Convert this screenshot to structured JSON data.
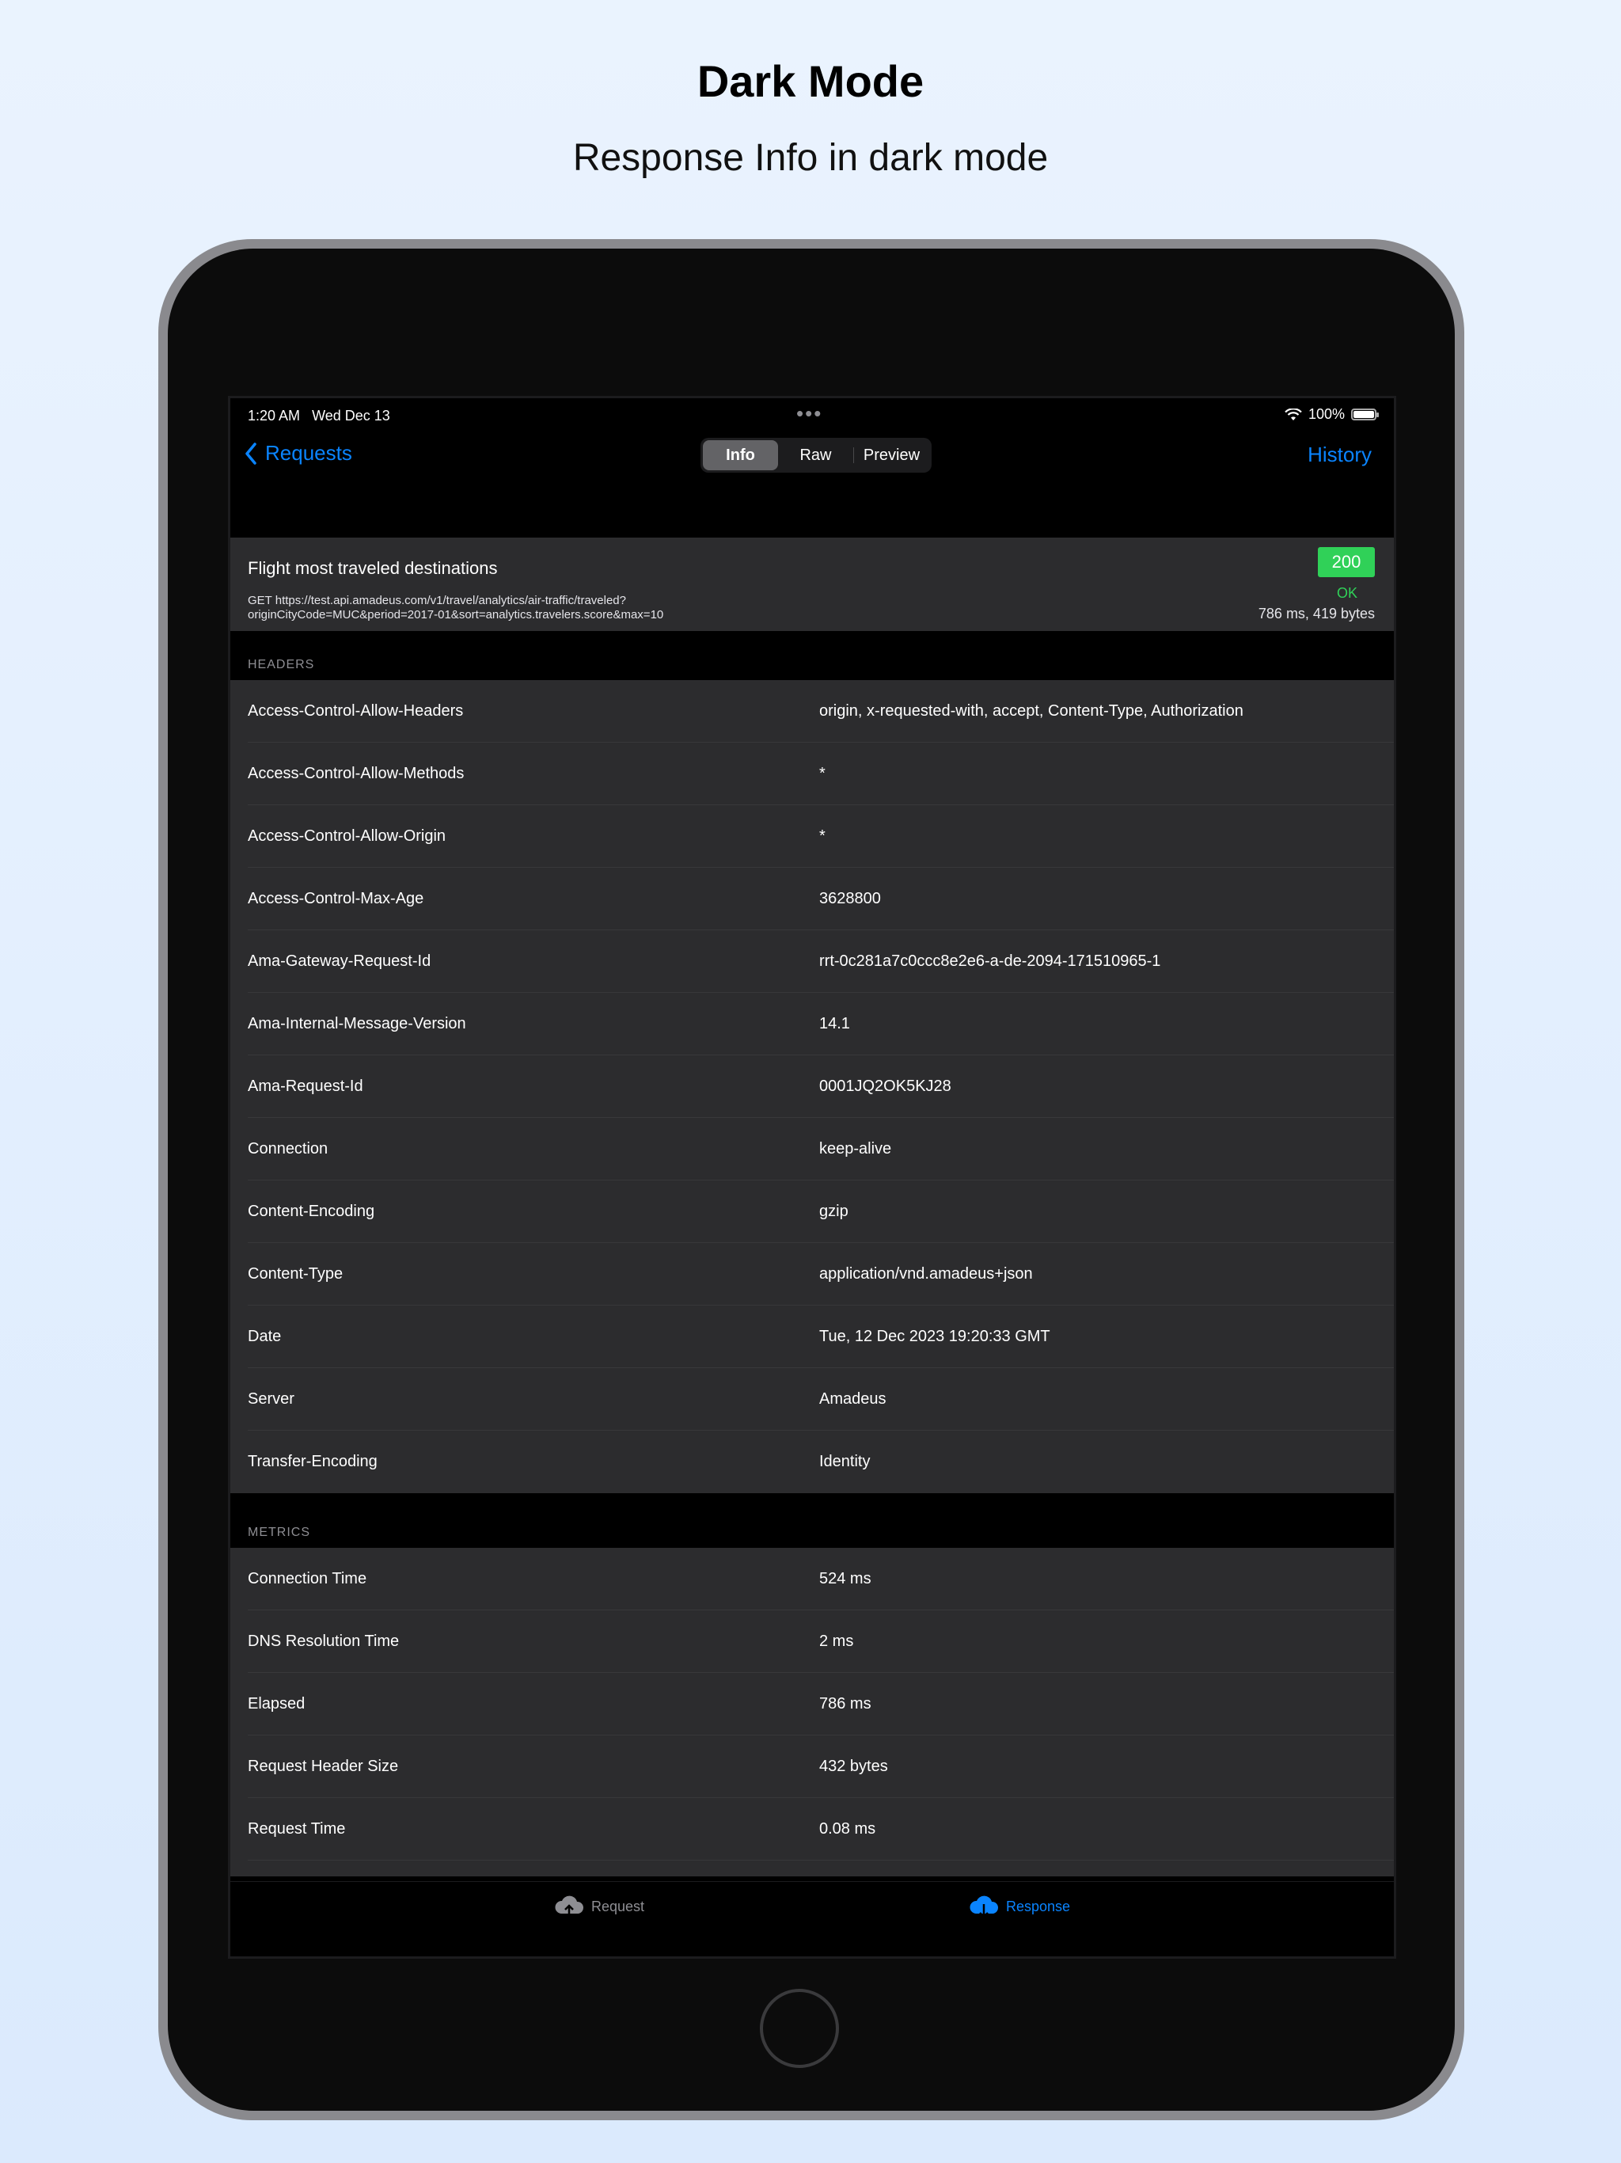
{
  "promo": {
    "title": "Dark Mode",
    "subtitle": "Response Info in dark mode"
  },
  "status_bar": {
    "time": "1:20 AM",
    "date": "Wed Dec 13",
    "battery": "100%"
  },
  "nav": {
    "back_label": "Requests",
    "segments": [
      "Info",
      "Raw",
      "Preview"
    ],
    "selected_segment": "Info",
    "history_label": "History"
  },
  "summary": {
    "title": "Flight most traveled destinations",
    "url_line1": "GET https://test.api.amadeus.com/v1/travel/analytics/air-traffic/traveled?",
    "url_line2": "originCityCode=MUC&period=2017-01&sort=analytics.travelers.score&max=10",
    "status_code": "200",
    "status_text": "OK",
    "timing": "786 ms, 419 bytes"
  },
  "headers": {
    "title": "HEADERS",
    "rows": [
      {
        "key": "Access-Control-Allow-Headers",
        "value": "origin, x-requested-with, accept, Content-Type, Authorization"
      },
      {
        "key": "Access-Control-Allow-Methods",
        "value": "*"
      },
      {
        "key": "Access-Control-Allow-Origin",
        "value": "*"
      },
      {
        "key": "Access-Control-Max-Age",
        "value": "3628800"
      },
      {
        "key": "Ama-Gateway-Request-Id",
        "value": "rrt-0c281a7c0ccc8e2e6-a-de-2094-171510965-1"
      },
      {
        "key": "Ama-Internal-Message-Version",
        "value": "14.1"
      },
      {
        "key": "Ama-Request-Id",
        "value": "0001JQ2OK5KJ28"
      },
      {
        "key": "Connection",
        "value": "keep-alive"
      },
      {
        "key": "Content-Encoding",
        "value": "gzip"
      },
      {
        "key": "Content-Type",
        "value": "application/vnd.amadeus+json"
      },
      {
        "key": "Date",
        "value": "Tue, 12 Dec 2023 19:20:33 GMT"
      },
      {
        "key": "Server",
        "value": "Amadeus"
      },
      {
        "key": "Transfer-Encoding",
        "value": "Identity"
      }
    ]
  },
  "metrics": {
    "title": "METRICS",
    "rows": [
      {
        "key": "Connection Time",
        "value": "524 ms"
      },
      {
        "key": "DNS Resolution Time",
        "value": "2 ms"
      },
      {
        "key": "Elapsed",
        "value": "786 ms"
      },
      {
        "key": "Request Header Size",
        "value": "432 bytes"
      },
      {
        "key": "Request Time",
        "value": "0.08 ms"
      }
    ]
  },
  "tab_bar": {
    "request_label": "Request",
    "response_label": "Response"
  },
  "colors": {
    "accent": "#0a84ff",
    "success": "#30d158",
    "cell_background": "#2c2c2e"
  }
}
